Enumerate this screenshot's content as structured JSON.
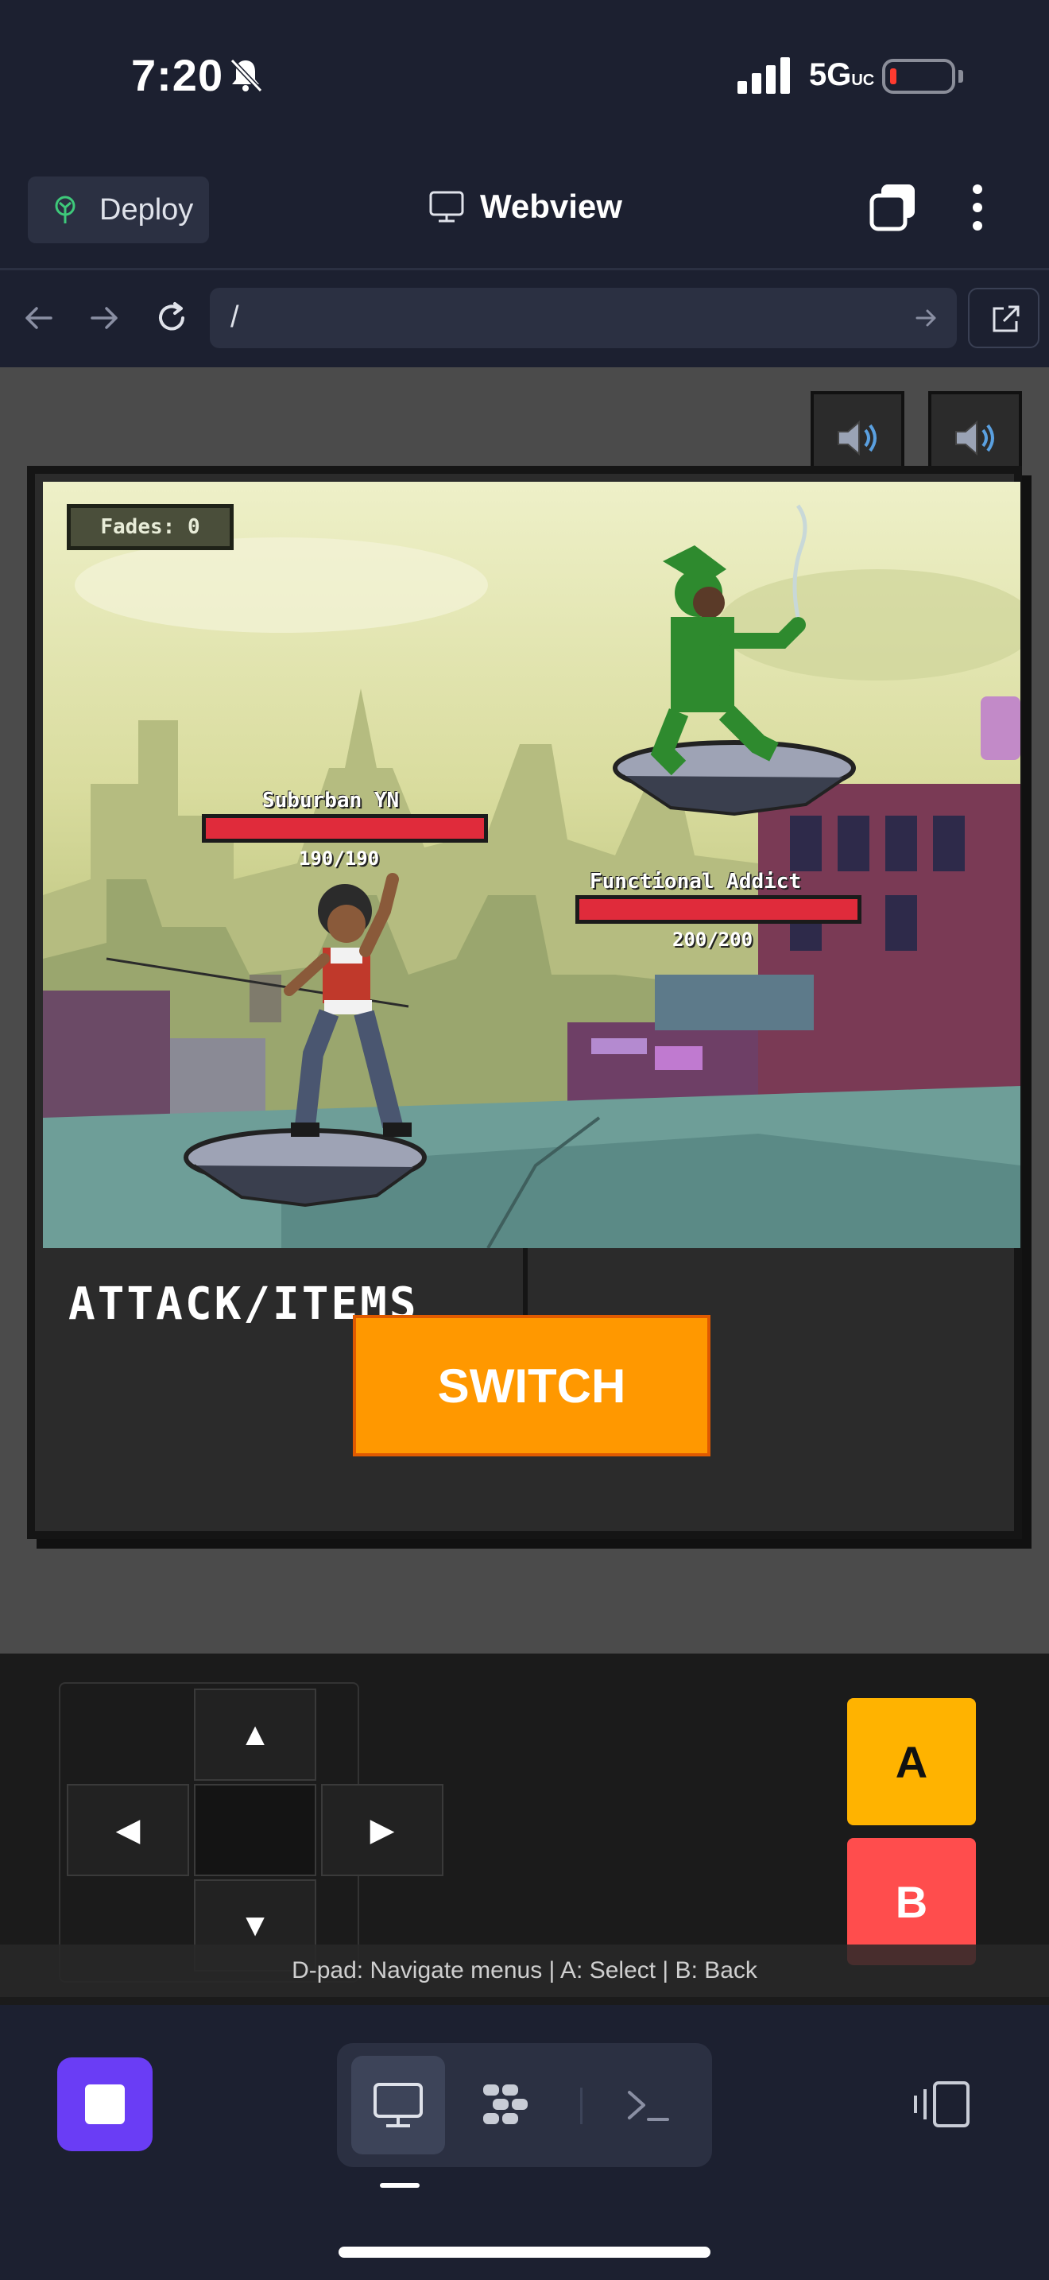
{
  "status_bar": {
    "time": "7:20",
    "network": "5G",
    "network_suffix": "UC"
  },
  "top_bar": {
    "deploy_label": "Deploy",
    "title": "Webview",
    "icons": [
      "deploy-icon",
      "monitor-icon",
      "tabs-icon",
      "more-icon"
    ]
  },
  "url_bar": {
    "value": "/"
  },
  "game": {
    "fades_label": "Fades: 0",
    "player": {
      "name": "Suburban YN",
      "hp": "190/190",
      "hp_fraction": 1.0
    },
    "enemy": {
      "name": "Functional Addict",
      "hp": "200/200",
      "hp_fraction": 1.0
    },
    "menu_tab_label": "ATTACK/ITEMS",
    "switch_label": "SWITCH",
    "colors": {
      "switch": "#ff9800",
      "hp_fill": "#e02b3b",
      "a_button": "#ffb300",
      "b_button": "#ff4d4d"
    }
  },
  "controls": {
    "up": "▲",
    "down": "▼",
    "left": "◀",
    "right": "▶",
    "a_label": "A",
    "b_label": "B",
    "hint": "D-pad: Navigate menus | A: Select | B: Back"
  },
  "bottom_bar": {
    "accent": "#6a3df5",
    "icons": [
      "stop-icon",
      "monitor-icon",
      "workspace-icon",
      "terminal-icon",
      "layout-icon"
    ]
  }
}
